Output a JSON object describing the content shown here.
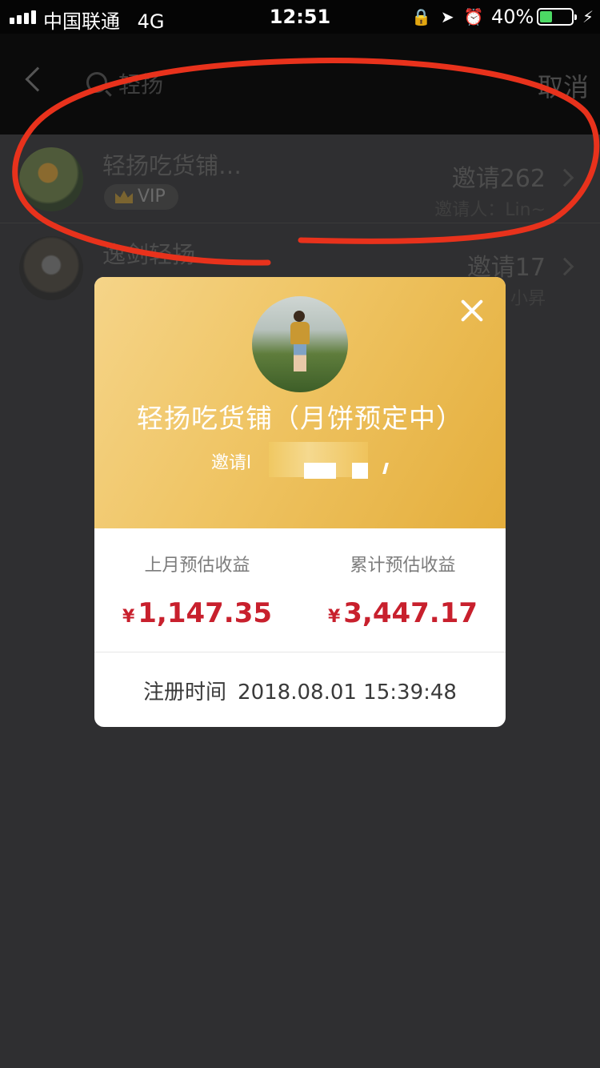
{
  "status_bar": {
    "carrier": "中国联通",
    "network": "4G",
    "time": "12:51",
    "battery_percent": "40%",
    "battery_level": 0.4,
    "icons": [
      "rotation-lock-icon",
      "location-arrow-icon",
      "alarm-icon",
      "battery-icon",
      "charging-bolt-icon"
    ]
  },
  "nav": {
    "search_value": "轻扬",
    "cancel_label": "取消"
  },
  "results": [
    {
      "name": "轻扬吃货铺…",
      "badge": "VIP",
      "invite_count": "邀请262",
      "inviter": "邀请人：Lin~"
    },
    {
      "name": "逸剑轻扬",
      "invite_count": "邀请17",
      "inviter": "小昇"
    }
  ],
  "modal": {
    "title": "轻扬吃货铺（月饼预定中）",
    "subtitle": "邀请l",
    "stats": [
      {
        "label": "上月预估收益",
        "currency": "¥",
        "value": "1,147.35"
      },
      {
        "label": "累计预估收益",
        "currency": "¥",
        "value": "3,447.17"
      }
    ],
    "register_label": "注册时间",
    "register_time": "2018.08.01 15:39:48"
  },
  "colors": {
    "annotation": "#e8321c",
    "gold_start": "#f5d488",
    "gold_end": "#e4ae3c",
    "amount_red": "#c8202d",
    "battery_green": "#4cd964"
  }
}
